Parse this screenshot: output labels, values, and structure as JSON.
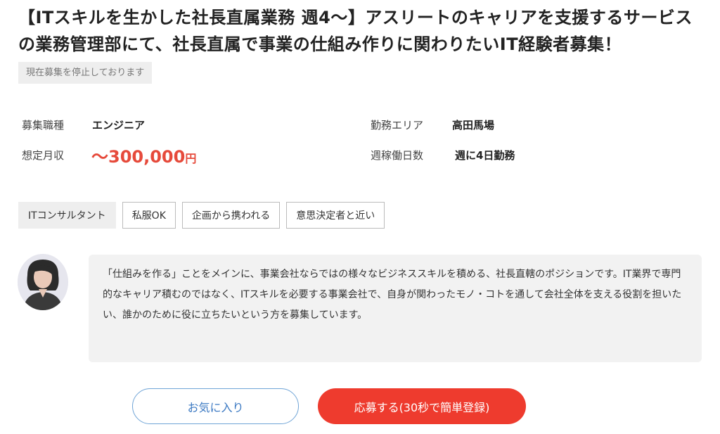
{
  "job": {
    "title": "【ITスキルを生かした社長直属業務 週4〜】アスリートのキャリアを支援するサービスの業務管理部にて、社長直属で事業の仕組み作りに関わりたいIT経験者募集！",
    "status": "現在募集を停止しております"
  },
  "info": {
    "occupation_label": "募集職種",
    "occupation_value": "エンジニア",
    "salary_label": "想定月収",
    "salary_amount": "〜300,000",
    "salary_unit": "円",
    "area_label": "勤務エリア",
    "area_value": "高田馬場",
    "days_label": "週稼働日数",
    "days_value": "週に4日勤務"
  },
  "tags": {
    "t0": "ITコンサルタント",
    "t1": "私服OK",
    "t2": "企画から携われる",
    "t3": "意思決定者と近い"
  },
  "message": {
    "text": "「仕組みを作る」ことをメインに、事業会社ならではの様々なビジネススキルを積める、社長直轄のポジションです。IT業界で専門的なキャリア積むのではなく、ITスキルを必要する事業会社で、自身が関わったモノ・コトを通して会社全体を支える役割を担いたい、誰かのために役に立ちたいという方を募集しています。"
  },
  "actions": {
    "favorite_label": "お気に入り",
    "apply_label": "応募する(30秒で簡単登録)"
  },
  "colors": {
    "accent_red": "#ee3b2e",
    "salary_red": "#e64a3b",
    "favorite_blue": "#3a78c2"
  }
}
